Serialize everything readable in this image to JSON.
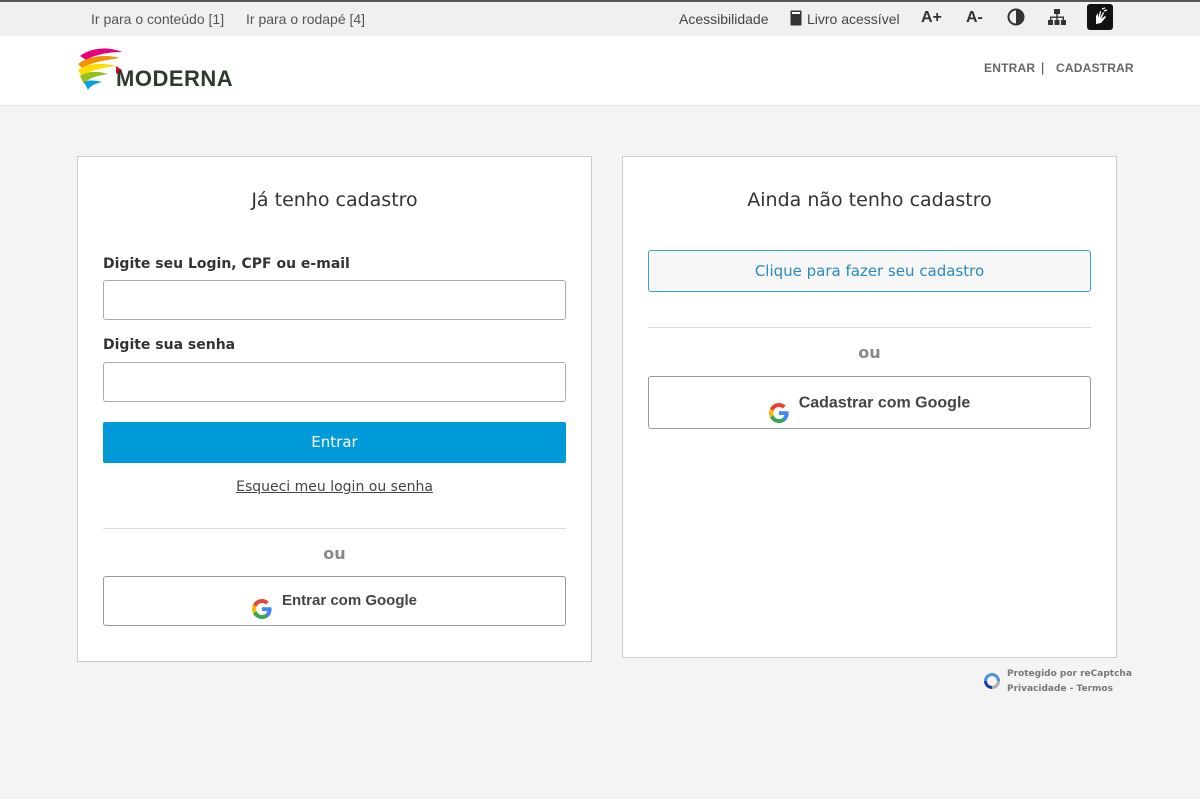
{
  "topbar": {
    "skip_content": "Ir para o conteúdo [1]",
    "skip_footer": "Ir para o rodapé [4]",
    "accessibility": "Acessibilidade",
    "accessible_book": "Livro acessível",
    "font_increase": "A+",
    "font_decrease": "A-"
  },
  "header": {
    "logo_text": "MODERNA",
    "login": "ENTRAR",
    "separator": "|",
    "register": "CADASTRAR"
  },
  "login_card": {
    "title": "Já tenho cadastro",
    "login_label": "Digite seu Login, CPF ou e-mail",
    "login_value": "",
    "password_label": "Digite sua senha",
    "password_value": "",
    "submit": "Entrar",
    "forgot": "Esqueci meu login ou senha",
    "or": "ou",
    "google": "Entrar com Google"
  },
  "register_card": {
    "title": "Ainda não tenho cadastro",
    "register_button": "Clique para fazer seu cadastro",
    "or": "ou",
    "google": "Cadastrar com Google"
  },
  "recaptcha": {
    "line1": "Protegido por reCaptcha",
    "line2": "Privacidade - Termos"
  },
  "colors": {
    "primary": "#009ad9",
    "outline": "#3a9fd0",
    "text": "#333333"
  }
}
